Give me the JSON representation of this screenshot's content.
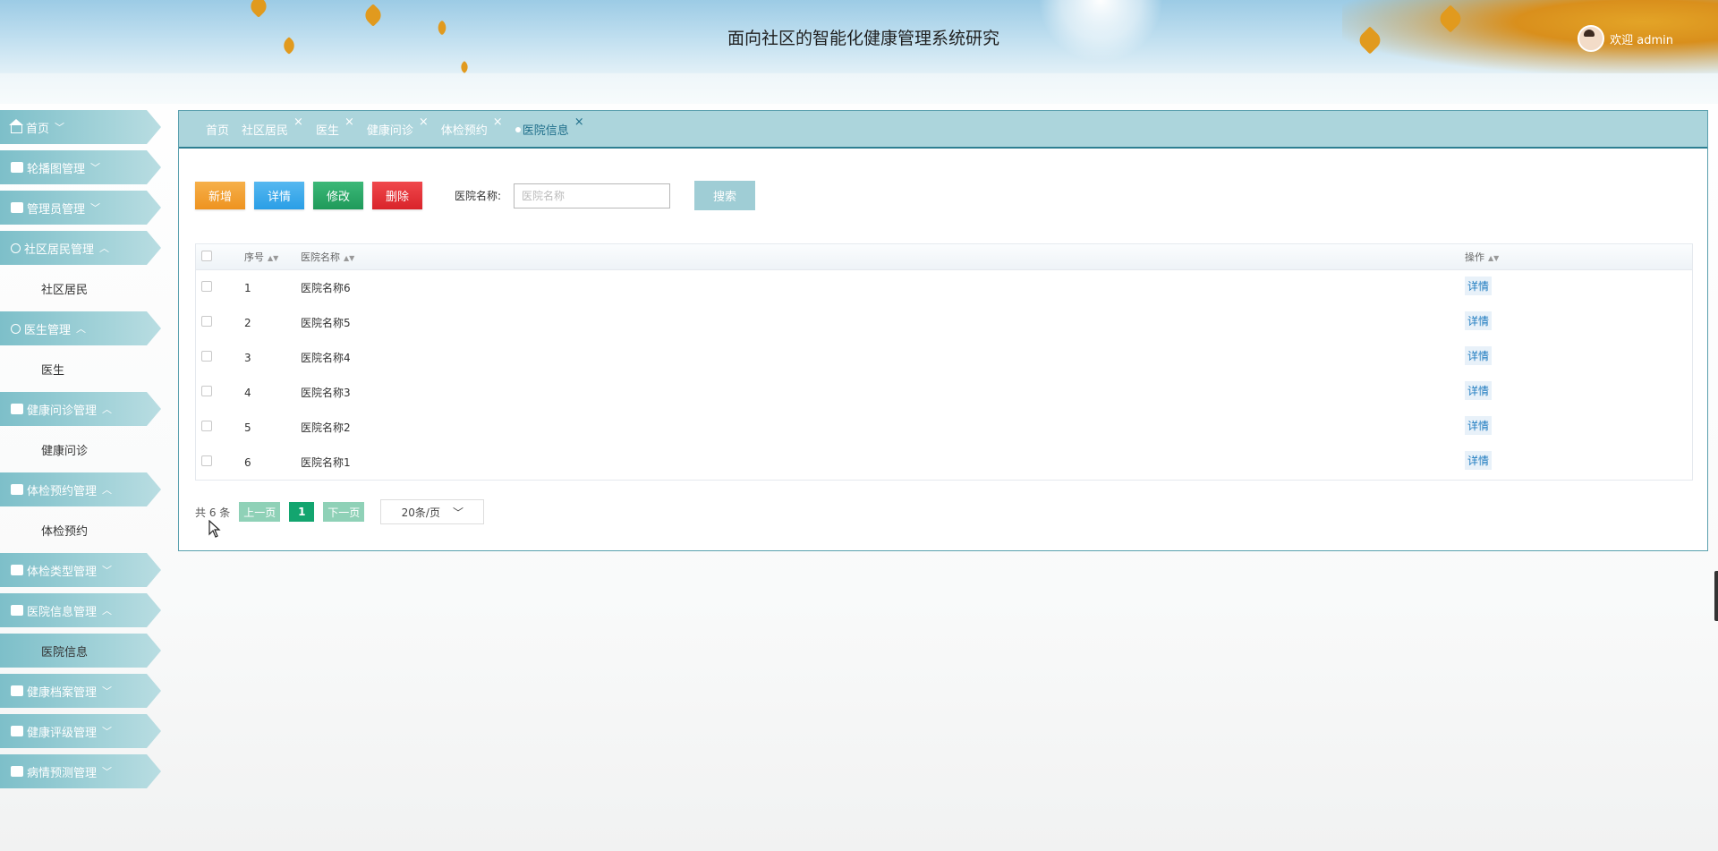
{
  "header": {
    "title": "面向社区的智能化健康管理系统研究",
    "welcome": "欢迎 admin"
  },
  "sidebar": {
    "items": [
      {
        "label": "首页",
        "arrow": "﹀",
        "icon": "home-icon"
      },
      {
        "label": "轮播图管理",
        "arrow": "﹀",
        "icon": "grid-icon"
      },
      {
        "label": "管理员管理",
        "arrow": "﹀",
        "icon": "grid-icon"
      },
      {
        "label": "社区居民管理",
        "arrow": "︿",
        "icon": "users-icon",
        "sub": "社区居民"
      },
      {
        "label": "医生管理",
        "arrow": "︿",
        "icon": "person-icon",
        "sub": "医生"
      },
      {
        "label": "健康问诊管理",
        "arrow": "︿",
        "icon": "document-icon",
        "sub": "健康问诊"
      },
      {
        "label": "体检预约管理",
        "arrow": "︿",
        "icon": "car-icon",
        "sub": "体检预约"
      },
      {
        "label": "体检类型管理",
        "arrow": "﹀",
        "icon": "list-icon"
      },
      {
        "label": "医院信息管理",
        "arrow": "︿",
        "icon": "grid-icon",
        "sub": "医院信息"
      },
      {
        "label": "健康档案管理",
        "arrow": "﹀",
        "icon": "folder-icon"
      },
      {
        "label": "健康评级管理",
        "arrow": "﹀",
        "icon": "archive-icon"
      },
      {
        "label": "病情预测管理",
        "arrow": "﹀",
        "icon": "chart-icon"
      }
    ]
  },
  "tabs": [
    {
      "label": "首页",
      "closable": false
    },
    {
      "label": "社区居民",
      "closable": true
    },
    {
      "label": "医生",
      "closable": true
    },
    {
      "label": "健康问诊",
      "closable": true
    },
    {
      "label": "体检预约",
      "closable": true
    },
    {
      "label": "医院信息",
      "closable": true,
      "active": true
    }
  ],
  "tab_close": "×",
  "toolbar": {
    "add": "新增",
    "detail": "详情",
    "edit": "修改",
    "delete": "删除",
    "search_label": "医院名称:",
    "search_placeholder": "医院名称",
    "search_button": "搜索"
  },
  "table": {
    "headers": {
      "index": "序号",
      "name": "医院名称",
      "action": "操作"
    },
    "sort_icon": "▲▼",
    "rows": [
      {
        "index": "1",
        "name": "医院名称6",
        "action": "详情"
      },
      {
        "index": "2",
        "name": "医院名称5",
        "action": "详情"
      },
      {
        "index": "3",
        "name": "医院名称4",
        "action": "详情"
      },
      {
        "index": "4",
        "name": "医院名称3",
        "action": "详情"
      },
      {
        "index": "5",
        "name": "医院名称2",
        "action": "详情"
      },
      {
        "index": "6",
        "name": "医院名称1",
        "action": "详情"
      }
    ]
  },
  "pagination": {
    "total": "共 6 条",
    "prev": "上一页",
    "current": "1",
    "next": "下一页",
    "page_size": "20条/页",
    "page_size_arrow": "﹀"
  },
  "colors": {
    "accent": "#2e7f92",
    "menu": "#7dbfc9",
    "add": "#ee9320",
    "detail": "#2a9ee6",
    "edit": "#1f9a5a",
    "delete": "#d9232a"
  }
}
